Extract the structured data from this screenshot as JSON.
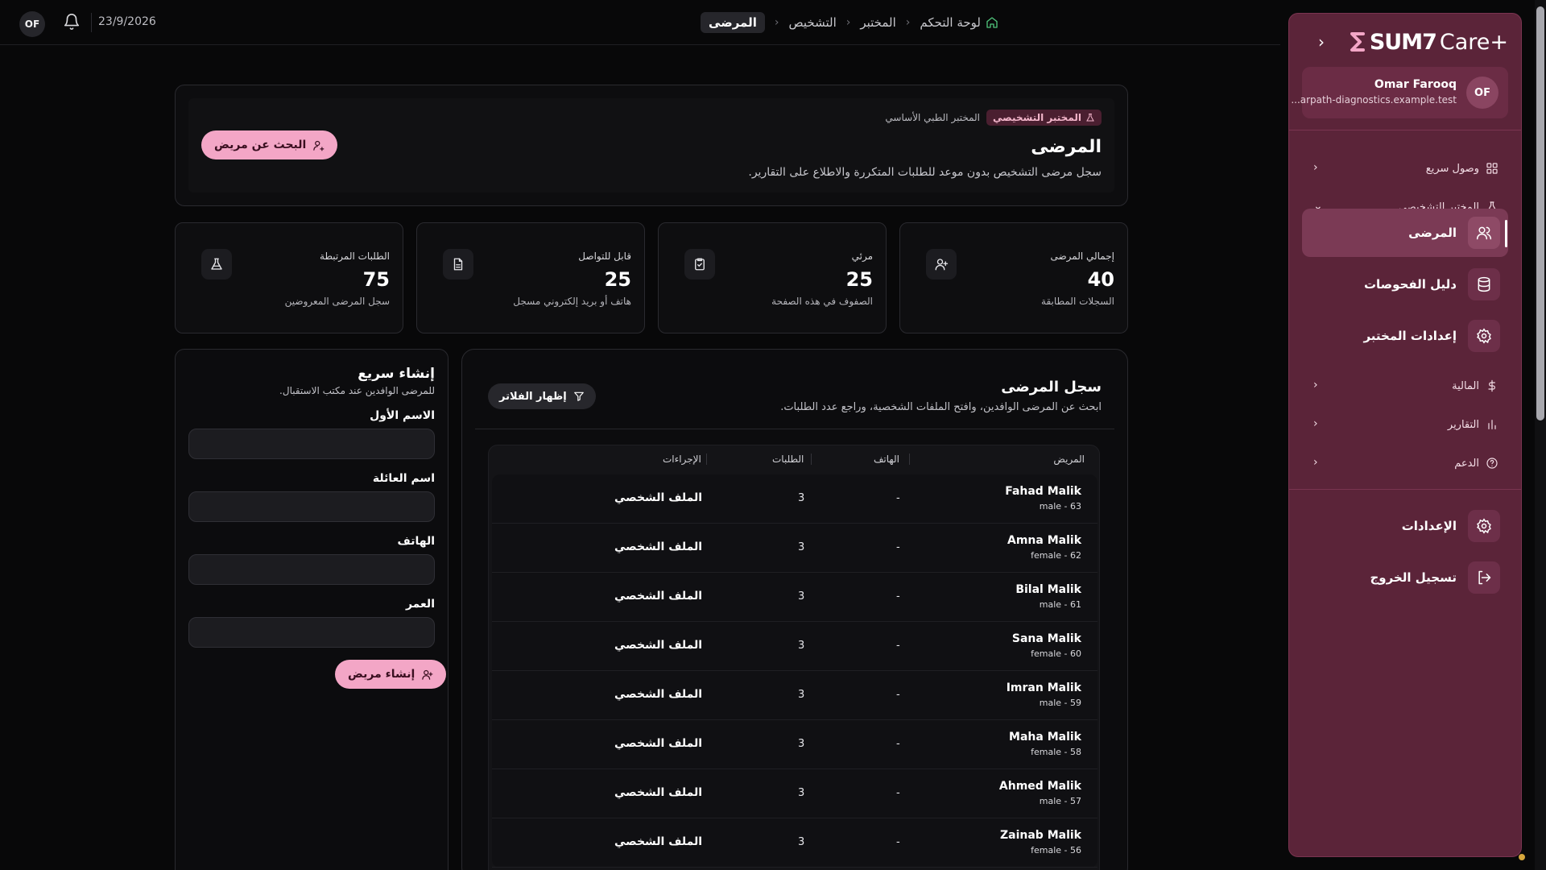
{
  "topbar": {
    "avatar_initials": "OF",
    "date": "23/9/2026",
    "breadcrumb": [
      {
        "label": "لوحة التحكم",
        "icon": "home-icon"
      },
      {
        "label": "المختبر"
      },
      {
        "label": "التشخيص"
      },
      {
        "label": "المرضى",
        "current": true
      }
    ]
  },
  "sidebar": {
    "logo": {
      "brand": "SUM7",
      "product": "Care+"
    },
    "user": {
      "initials": "OF",
      "name": "Omar Farooq",
      "email": "...arpath-diagnostics.example.test"
    },
    "groups": [
      {
        "label": "وصول سريع",
        "icon": "grid-icon"
      },
      {
        "label": "المختبر التشخيصي",
        "icon": "flask-icon"
      }
    ],
    "lab_items": [
      {
        "label": "المرضى",
        "icon": "users-icon",
        "active": true
      },
      {
        "label": "دليل الفحوصات",
        "icon": "database-icon"
      },
      {
        "label": "إعدادات المختبر",
        "icon": "gear-icon"
      }
    ],
    "more_groups": [
      {
        "label": "المالية",
        "icon": "dollar-icon"
      },
      {
        "label": "التقارير",
        "icon": "bar-chart-icon"
      },
      {
        "label": "الدعم",
        "icon": "help-circle-icon"
      }
    ],
    "bottom_items": [
      {
        "label": "الإعدادات",
        "icon": "gear-icon"
      },
      {
        "label": "تسجيل الخروج",
        "icon": "logout-icon"
      }
    ]
  },
  "header": {
    "tag_primary": "المختبر التشخيصي",
    "tag_secondary": "المختبر الطبي الأساسي",
    "title": "المرضى",
    "description": "سجل مرضى التشخيص بدون موعد للطلبات المتكررة والاطلاع على التقارير.",
    "search_button": "البحث عن مريض"
  },
  "stats": [
    {
      "label": "إجمالي المرضى",
      "value": "40",
      "sub": "السجلات المطابقة",
      "icon": "user-plus-icon"
    },
    {
      "label": "مرئي",
      "value": "25",
      "sub": "الصفوف في هذه الصفحة",
      "icon": "clipboard-icon"
    },
    {
      "label": "قابل للتواصل",
      "value": "25",
      "sub": "هاتف أو بريد إلكتروني مسجل",
      "icon": "file-text-icon"
    },
    {
      "label": "الطلبات المرتبطة",
      "value": "75",
      "sub": "سجل المرضى المعروضين",
      "icon": "flask-icon"
    }
  ],
  "registry": {
    "title": "سجل المرضى",
    "description": "ابحث عن المرضى الوافدين، وافتح الملفات الشخصية، وراجع عدد الطلبات.",
    "filter_button": "إظهار الفلاتر",
    "columns": {
      "patient": "المريض",
      "phone": "الهاتف",
      "orders": "الطلبات",
      "actions": "الإجراءات"
    },
    "rows": [
      {
        "name": "Fahad Malik",
        "meta": "male - 63",
        "phone": "-",
        "orders": "3",
        "action": "الملف الشخصي"
      },
      {
        "name": "Amna Malik",
        "meta": "female - 62",
        "phone": "-",
        "orders": "3",
        "action": "الملف الشخصي"
      },
      {
        "name": "Bilal Malik",
        "meta": "male - 61",
        "phone": "-",
        "orders": "3",
        "action": "الملف الشخصي"
      },
      {
        "name": "Sana Malik",
        "meta": "female - 60",
        "phone": "-",
        "orders": "3",
        "action": "الملف الشخصي"
      },
      {
        "name": "Imran Malik",
        "meta": "male - 59",
        "phone": "-",
        "orders": "3",
        "action": "الملف الشخصي"
      },
      {
        "name": "Maha Malik",
        "meta": "female - 58",
        "phone": "-",
        "orders": "3",
        "action": "الملف الشخصي"
      },
      {
        "name": "Ahmed Malik",
        "meta": "male - 57",
        "phone": "-",
        "orders": "3",
        "action": "الملف الشخصي"
      },
      {
        "name": "Zainab Malik",
        "meta": "female - 56",
        "phone": "-",
        "orders": "3",
        "action": "الملف الشخصي"
      }
    ]
  },
  "quick_create": {
    "title": "إنشاء سريع",
    "subtitle": "للمرضى الوافدين عند مكتب الاستقبال.",
    "first_name_label": "الاسم الأول",
    "first_name_value": "",
    "last_name_label": "اسم العائلة",
    "last_name_value": "",
    "phone_label": "الهاتف",
    "phone_value": "",
    "age_label": "العمر",
    "age_value": "",
    "submit_button": "إنشاء مريض"
  },
  "colors": {
    "background": "#080809",
    "sidebar": "#5b2439",
    "accent_pink": "#f3a6c6",
    "active_item": "#7b3a55"
  }
}
